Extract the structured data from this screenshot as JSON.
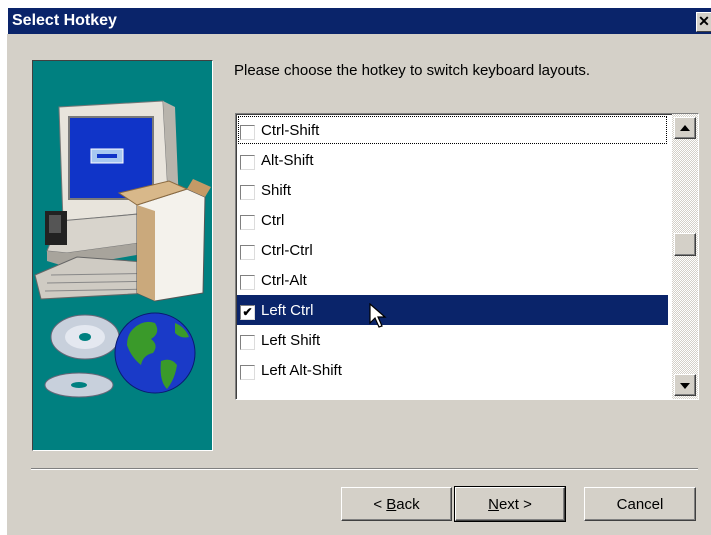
{
  "window": {
    "title": "Select Hotkey",
    "close_glyph": "✕"
  },
  "instruction": "Please choose the hotkey to switch keyboard layouts.",
  "hotkeys": [
    {
      "label": "Ctrl-Shift",
      "checked": false
    },
    {
      "label": "Alt-Shift",
      "checked": false
    },
    {
      "label": "Shift",
      "checked": false
    },
    {
      "label": "Ctrl",
      "checked": false
    },
    {
      "label": "Ctrl-Ctrl",
      "checked": false
    },
    {
      "label": "Ctrl-Alt",
      "checked": false
    },
    {
      "label": "Left Ctrl",
      "checked": true,
      "selected": true
    },
    {
      "label": "Left Shift",
      "checked": false
    },
    {
      "label": "Left Alt-Shift",
      "checked": false
    }
  ],
  "buttons": {
    "back": {
      "prefix": "< ",
      "mnemonic": "B",
      "rest": "ack"
    },
    "next": {
      "mnemonic": "N",
      "rest": "ext >"
    },
    "cancel": "Cancel"
  },
  "colors": {
    "title_bar": "#0a246a",
    "illustration_bg": "#008080",
    "selection": "#0a246a",
    "dialog_bg": "#d4d0c8"
  },
  "icons": {
    "illustration": "computer-with-globe-and-cds",
    "pointer": "arrow-cursor-icon"
  }
}
